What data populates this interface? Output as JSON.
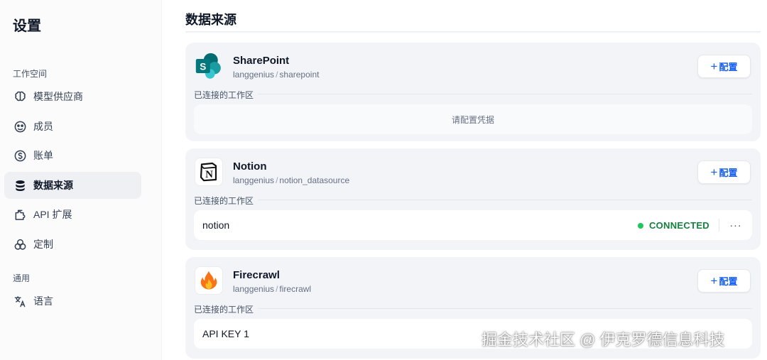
{
  "sidebar": {
    "title": "设置",
    "workspace_section": "工作空间",
    "general_section": "通用",
    "items": [
      {
        "label": "模型供应商",
        "icon": "brain-icon"
      },
      {
        "label": "成员",
        "icon": "members-icon"
      },
      {
        "label": "账单",
        "icon": "dollar-icon"
      },
      {
        "label": "数据来源",
        "icon": "database-icon",
        "active": true
      },
      {
        "label": "API 扩展",
        "icon": "puzzle-icon"
      },
      {
        "label": "定制",
        "icon": "shapes-icon"
      },
      {
        "label": "语言",
        "icon": "translate-icon"
      }
    ]
  },
  "main": {
    "title": "数据来源",
    "config_label": "配置",
    "config_plus": "+",
    "workspace_label": "已连接的工作区",
    "sources": [
      {
        "name": "SharePoint",
        "owner": "langgenius",
        "sep": "/",
        "plugin": "sharepoint",
        "empty_text": "请配置凭据"
      },
      {
        "name": "Notion",
        "owner": "langgenius",
        "sep": "/",
        "plugin": "notion_datasource",
        "workspace_name": "notion",
        "status": "CONNECTED",
        "more": "···"
      },
      {
        "name": "Firecrawl",
        "owner": "langgenius",
        "sep": "/",
        "plugin": "firecrawl",
        "workspace_name": "API KEY 1"
      }
    ]
  },
  "watermark": "掘金技术社区 @ 伊克罗德信息科技",
  "colors": {
    "accent": "#155eef",
    "connected": "#22c55e",
    "active_nav": "#eef0f3",
    "card_bg": "#f2f4f7"
  }
}
